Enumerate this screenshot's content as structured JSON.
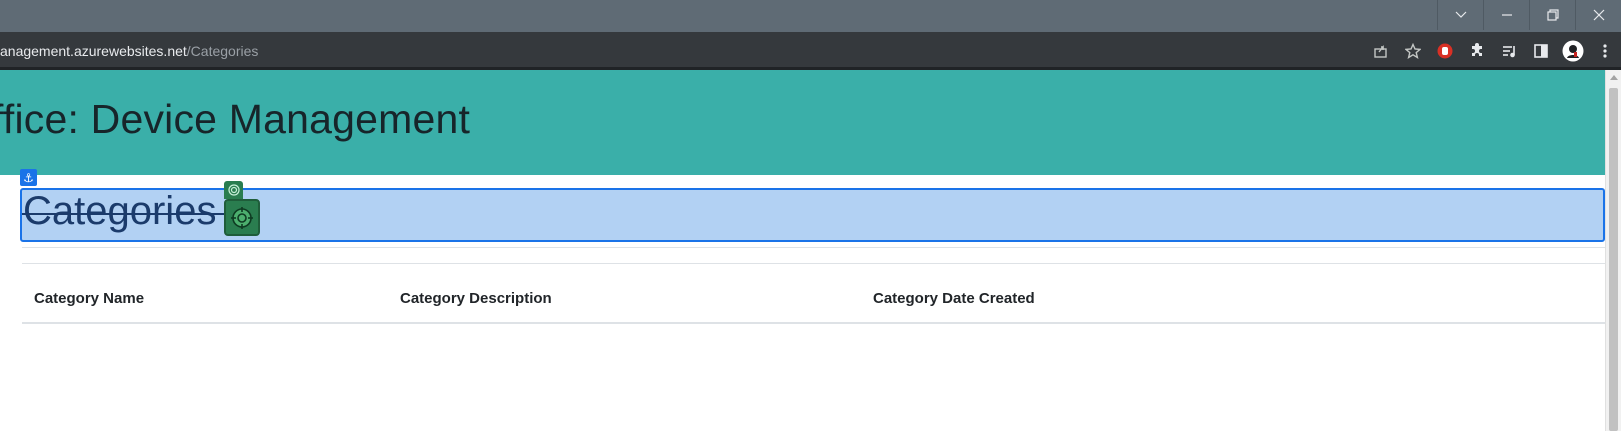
{
  "browser": {
    "url_host": "anagement.azurewebsites.net",
    "url_path": "/Categories",
    "window_buttons": [
      "chevron-down",
      "minimize",
      "restore",
      "close"
    ],
    "toolbar_icons": [
      "share-icon",
      "bookmark-star-icon",
      "extension-stop-icon",
      "extensions-puzzle-icon",
      "reading-list-icon",
      "side-panel-icon",
      "profile-avatar-icon",
      "menu-kebab-icon"
    ]
  },
  "header": {
    "title": "ffice: Device Management",
    "bg_color": "#3aafa9"
  },
  "main": {
    "page_title": "Categories",
    "table": {
      "columns": [
        "Category Name",
        "Category Description",
        "Category Date Created"
      ],
      "rows": []
    }
  }
}
